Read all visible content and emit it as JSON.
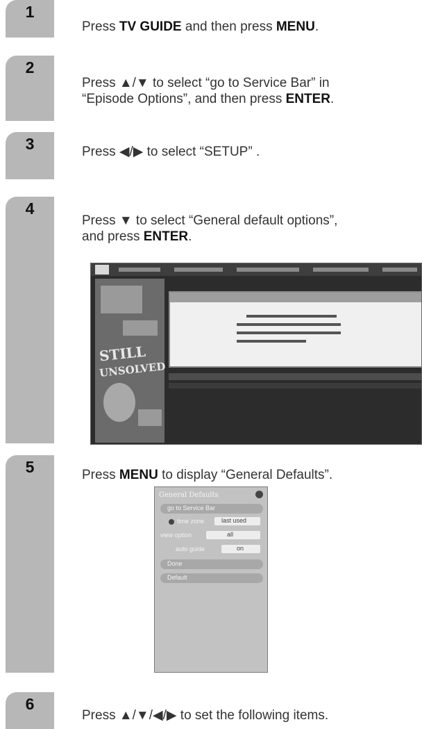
{
  "steps": [
    {
      "number": "1",
      "line1_pre": "Press ",
      "line1_b1": "TV GUIDE",
      "line1_mid": " and then press ",
      "line1_b2": "MENU",
      "line1_post": "."
    },
    {
      "number": "2",
      "line1": "Press ▲/▼ to select “go to Service Bar” in",
      "line2_pre": "“Episode Options”, and then press ",
      "line2_b": "ENTER",
      "line2_post": "."
    },
    {
      "number": "3",
      "line1": "Press ◀/▶ to select “SETUP” ."
    },
    {
      "number": "4",
      "line1": "Press ▼ to select “General default options”,",
      "line2_pre": "and press ",
      "line2_b": "ENTER",
      "line2_post": "."
    },
    {
      "number": "5",
      "line1_pre": "Press ",
      "line1_b": "MENU",
      "line1_post": " to display “General Defaults”."
    },
    {
      "number": "6",
      "line1": "Press ▲/▼/◀/▶ to set the following items."
    }
  ],
  "screen_image": {
    "poster_text1": "STILL",
    "poster_text2": "UNSOLVED"
  },
  "general_defaults_menu": {
    "title": "General Defaults",
    "items": [
      "go to Service Bar",
      "time zone",
      "view option",
      "auto guide",
      "Done",
      "Default"
    ],
    "values": [
      "last used",
      "all",
      "on"
    ]
  }
}
